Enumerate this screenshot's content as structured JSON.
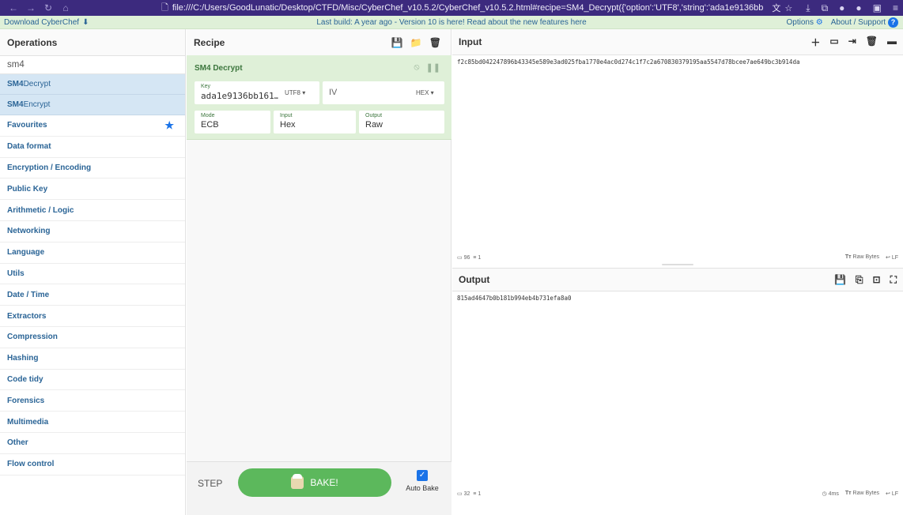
{
  "browser": {
    "url": "file:///C:/Users/GoodLunatic/Desktop/CTFD/Misc/CyberChef_v10.5.2/CyberChef_v10.5.2.html#recipe=SM4_Decrypt({'option':'UTF8','string':'ada1e9136bb"
  },
  "banner": {
    "download": "Download CyberChef",
    "message": "Last build: A year ago - Version 10 is here! Read about the new features here",
    "options": "Options",
    "about": "About / Support"
  },
  "operations": {
    "title": "Operations",
    "search": "sm4",
    "results": [
      {
        "bold": "SM4",
        "rest": " Decrypt"
      },
      {
        "bold": "SM4",
        "rest": " Encrypt"
      }
    ],
    "categories": [
      "Favourites",
      "Data format",
      "Encryption / Encoding",
      "Public Key",
      "Arithmetic / Logic",
      "Networking",
      "Language",
      "Utils",
      "Date / Time",
      "Extractors",
      "Compression",
      "Hashing",
      "Code tidy",
      "Forensics",
      "Multimedia",
      "Other",
      "Flow control"
    ]
  },
  "recipe": {
    "title": "Recipe",
    "operation": {
      "name": "SM4 Decrypt",
      "key_label": "Key",
      "key_value": "ada1e9136bb161…",
      "key_format": "UTF8",
      "iv_label": "IV",
      "iv_format": "HEX",
      "mode_label": "Mode",
      "mode_value": "ECB",
      "input_label": "Input",
      "input_value": "Hex",
      "output_label": "Output",
      "output_value": "Raw"
    },
    "step": "STEP",
    "bake": "BAKE!",
    "auto_bake": "Auto Bake"
  },
  "input": {
    "title": "Input",
    "text": "f2c85bd042247896b43345e589e3ad025fba1770e4ac0d274c1f7c2a670830379195aa5547d78bcee7ae649bc3b914da",
    "length": "96",
    "lines": "1",
    "raw_bytes": "Raw Bytes",
    "eol": "LF"
  },
  "output": {
    "title": "Output",
    "text": "815ad4647b0b181b994eb4b731efa8a0",
    "length": "32",
    "lines": "1",
    "time": "4ms",
    "raw_bytes": "Raw Bytes",
    "eol": "LF"
  },
  "colors": {
    "banner_bg": "#dff0d8",
    "link": "#2a6496",
    "bake_green": "#5cb85c",
    "accent_blue": "#1a73e8"
  }
}
